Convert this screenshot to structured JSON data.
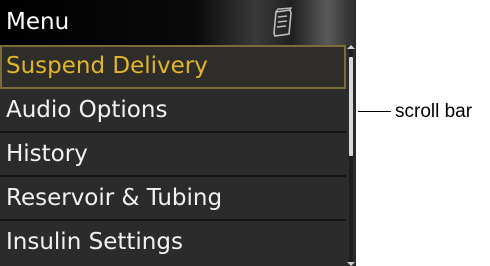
{
  "header": {
    "title": "Menu",
    "icon": "notepad-icon"
  },
  "menu": {
    "items": [
      {
        "label": "Suspend Delivery",
        "selected": true
      },
      {
        "label": "Audio Options",
        "selected": false
      },
      {
        "label": "History",
        "selected": false
      },
      {
        "label": "Reservoir & Tubing",
        "selected": false
      },
      {
        "label": "Insulin Settings",
        "selected": false
      }
    ]
  },
  "scrollbar": {
    "position_fraction": 0.0,
    "visible_fraction": 0.5
  },
  "annotation": {
    "label": "scroll bar"
  },
  "colors": {
    "selected_text": "#e3b52b",
    "item_text": "#f2f2f2",
    "background": "#2b2b2b",
    "selected_border": "#7a6d3a"
  }
}
